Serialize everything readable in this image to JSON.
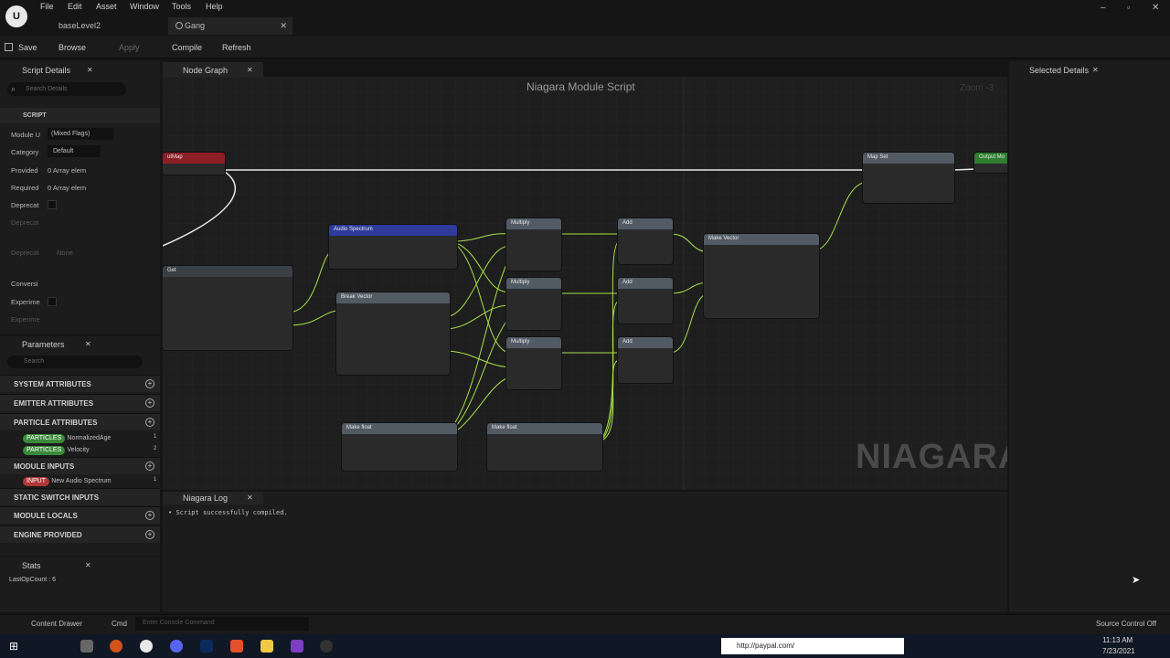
{
  "menu": [
    "File",
    "Edit",
    "Asset",
    "Window",
    "Tools",
    "Help"
  ],
  "tabs": {
    "level": "baseLevel2",
    "asset": "Gang"
  },
  "toolbar": {
    "save": "Save",
    "browse": "Browse",
    "apply": "Apply",
    "compile": "Compile",
    "refresh": "Refresh"
  },
  "script_details": {
    "title": "Script Details",
    "search_placeholder": "Search Details",
    "section": "SCRIPT",
    "rows": [
      {
        "label": "Module U",
        "value": "(Mixed Flags)"
      },
      {
        "label": "Category",
        "value": "Default"
      },
      {
        "label": "Provided",
        "value": "0 Array elem"
      },
      {
        "label": "Required",
        "value": "0 Array elem"
      },
      {
        "label": "Deprecat",
        "value": ""
      },
      {
        "label": "Deprecat",
        "value": ""
      },
      {
        "label": "Deprecat",
        "value": "None"
      },
      {
        "label": "Conversi",
        "value": ""
      },
      {
        "label": "Experime",
        "value": ""
      },
      {
        "label": "Experime",
        "value": ""
      }
    ]
  },
  "parameters": {
    "title": "Parameters",
    "search_placeholder": "Search",
    "sections": {
      "system": "SYSTEM ATTRIBUTES",
      "emitter": "EMITTER ATTRIBUTES",
      "particle": "PARTICLE ATTRIBUTES",
      "module_inputs": "MODULE INPUTS",
      "static_switch": "STATIC SWITCH INPUTS",
      "module_locals": "MODULE LOCALS",
      "engine": "ENGINE PROVIDED"
    },
    "particle_items": [
      {
        "badge": "PARTICLES",
        "name": "NormalizedAge",
        "count": "1"
      },
      {
        "badge": "PARTICLES",
        "name": "Velocity",
        "count": "2"
      }
    ],
    "input_items": [
      {
        "badge": "INPUT",
        "name": "New Audio Spectrum",
        "count": "1"
      }
    ]
  },
  "stats": {
    "title": "Stats",
    "line": "LastOpCount : 6"
  },
  "node_graph": {
    "tab": "Node Graph",
    "title": "Niagara Module Script",
    "zoom": "Zoom -3",
    "watermark": "NIAGARA",
    "nodes": {
      "audio": "Audio Spectrum",
      "break": "Break Vector",
      "mul1": "Multiply",
      "mul2": "Multiply",
      "mul3": "Multiply",
      "add1": "Add",
      "add2": "Add",
      "add3": "Add",
      "make_vector": "Make Vector",
      "map_set": "Map Set",
      "output": "Output Mo",
      "make_float1": "Make float",
      "make_float2": "Make float",
      "map_get": "Get",
      "input_map": "utMap"
    }
  },
  "log": {
    "title": "Niagara Log",
    "line": "Script successfully compiled."
  },
  "selected_details": {
    "title": "Selected Details"
  },
  "bottom": {
    "content_drawer": "Content Drawer",
    "cmd": "Cmd",
    "console_placeholder": "Enter Console Command",
    "source_control": "Source Control Off"
  },
  "taskbar": {
    "url": "http://paypal.com/",
    "time": "11:13 AM",
    "date": "7/23/2021"
  },
  "colors": {
    "green_wire": "#a7e04a",
    "particles_badge": "#3a8a3a",
    "input_badge": "#b0383a",
    "audio_header": "#2e3b9a"
  }
}
